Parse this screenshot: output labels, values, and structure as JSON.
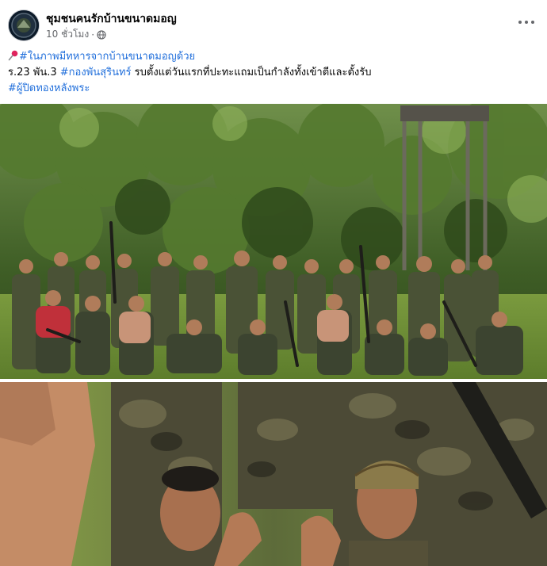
{
  "post": {
    "page_name": "ชุมชนคนรักบ้านขนาดมอญ",
    "time": "10 ชั่วโมง",
    "separator": "·",
    "audience_icon": "globe-icon",
    "more_icon": "more-options-icon",
    "text": {
      "line1_tag": "#ในภาพมีทหารจากบ้านขนาดมอญด้วย",
      "line2_prefix": "ร.23 พัน.3 ",
      "line2_tag": "#กองพันสุรินทร์",
      "line2_suffix": " รบตั้งแต่วันแรกที่ปะทะแถมเป็นกำลังทั้งเข้าตีและตั้งรับ",
      "line3_tag": "#ผู้ปิดทองหลังพระ"
    }
  },
  "colors": {
    "hashtag": "#216fdb",
    "meta_text": "#65676b",
    "pin": "#e0245e"
  },
  "photos": [
    {
      "name": "group-photo",
      "description_icon": "photo"
    },
    {
      "name": "closeup-photo",
      "description_icon": "photo"
    }
  ]
}
